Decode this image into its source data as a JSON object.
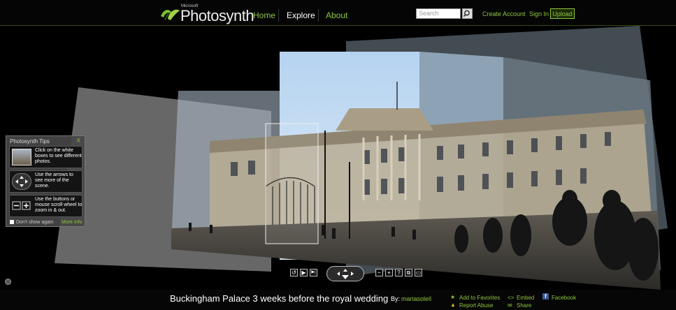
{
  "header": {
    "logo_small": "Microsoft",
    "logo_text": "Photosynth",
    "nav": [
      {
        "label": "Home"
      },
      {
        "label": "Explore"
      },
      {
        "label": "About"
      }
    ],
    "search": {
      "placeholder": "Search"
    },
    "links": {
      "create_account": "Create Account",
      "sign_in": "Sign In",
      "upload": "Upload"
    }
  },
  "tips": {
    "title": "Photosynth Tips",
    "close": "X",
    "items": [
      {
        "text": "Click on the white boxes to see different photos."
      },
      {
        "text": "Use the arrows to see more of the scene."
      },
      {
        "text": "Use the buttons or mouse scroll wheel to zoom in & out."
      }
    ],
    "dont_show": "Don't show again",
    "more_info": "More Info"
  },
  "controls": {
    "rotate": "↺",
    "play": "▶",
    "step": "▶|",
    "zoom_out": "−",
    "zoom_in": "+",
    "help": "?",
    "view": "⧉",
    "fullscreen": "▭"
  },
  "footer": {
    "title": "Buckingham Palace 3 weeks before the royal wedding",
    "by": "By:",
    "author": "mariasoleil",
    "add_favorites": "Add to Favorites",
    "embed": "Embed",
    "facebook": "Facebook",
    "report_abuse": "Report Abuse",
    "share": "Share"
  },
  "colors": {
    "accent": "#8dc63f",
    "background": "#000000"
  }
}
